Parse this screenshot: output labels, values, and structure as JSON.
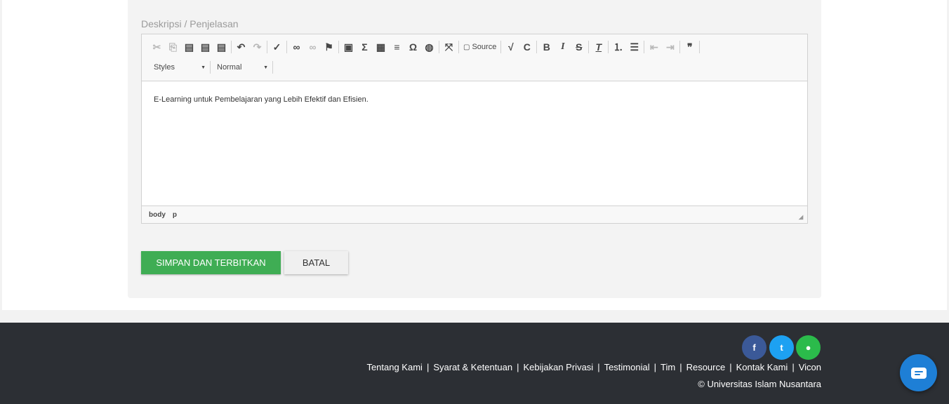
{
  "form": {
    "description_label": "Deskripsi / Penjelasan"
  },
  "editor": {
    "toolbar": {
      "source_label": "Source",
      "styles_label": "Styles",
      "format_label": "Normal"
    },
    "content": "E-Learning untuk Pembelajaran yang Lebih Efektif dan Efisien.",
    "path": [
      "body",
      "p"
    ]
  },
  "actions": {
    "save_label": "SIMPAN DAN TERBITKAN",
    "cancel_label": "BATAL"
  },
  "footer": {
    "links": [
      "Tentang Kami",
      "Syarat & Ketentuan",
      "Kebijakan Privasi",
      "Testimonial",
      "Tim",
      "Resource",
      "Kontak Kami",
      "Vicon"
    ],
    "separator": "|",
    "copyright": "© Universitas Islam Nusantara",
    "social": [
      {
        "name": "facebook",
        "glyph": "f",
        "color": "#3b5998"
      },
      {
        "name": "twitter",
        "glyph": "t",
        "color": "#1da1f2"
      },
      {
        "name": "line",
        "glyph": "●",
        "color": "#2bbb4b"
      }
    ]
  },
  "colors": {
    "primary_green": "#3fad54",
    "footer_bg": "#2c2f34",
    "chat_blue": "#1e7fd6"
  }
}
